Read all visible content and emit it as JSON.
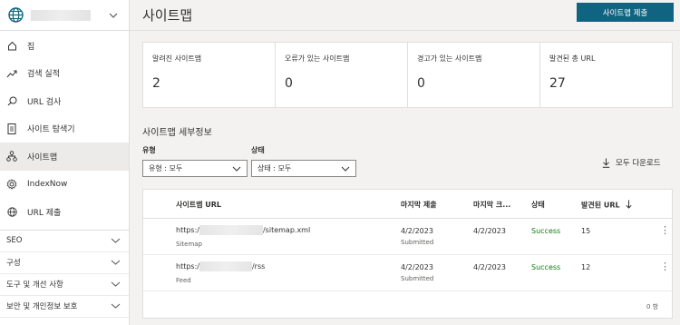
{
  "sidebar": {
    "items": [
      {
        "label": "집",
        "icon": "home-icon"
      },
      {
        "label": "검색 실적",
        "icon": "trend-icon"
      },
      {
        "label": "URL 검사",
        "icon": "search-icon"
      },
      {
        "label": "사이트 탐색기",
        "icon": "document-icon"
      },
      {
        "label": "사이트맵",
        "icon": "sitemap-icon",
        "active": true
      },
      {
        "label": "IndexNow",
        "icon": "gear-icon"
      },
      {
        "label": "URL 제출",
        "icon": "globe-icon"
      }
    ],
    "groups": [
      "SEO",
      "구성",
      "도구 및 개선 사항",
      "보안 및 개인정보 보호"
    ]
  },
  "header": {
    "title": "사이트맵",
    "submit_label": "사이트맵 제출"
  },
  "stats": [
    {
      "label": "알려진 사이트맵",
      "value": "2"
    },
    {
      "label": "오류가 있는 사이트맵",
      "value": "0"
    },
    {
      "label": "경고가 있는 사이트맵",
      "value": "0"
    },
    {
      "label": "발견된 총 URL",
      "value": "27"
    }
  ],
  "details": {
    "title": "사이트맵 세부정보",
    "type_label": "유형",
    "type_value": "유형 : 모두",
    "status_label": "상태",
    "status_value": "상태 : 모두",
    "download_label": "모두 다운로드"
  },
  "table": {
    "columns": [
      "사이트맵 URL",
      "마지막 제출",
      "마지막 크...",
      "상태",
      "발견된 URL"
    ],
    "rows": [
      {
        "url_prefix": "https:/",
        "url_suffix": "/sitemap.xml",
        "type": "Sitemap",
        "last_submitted": "4/2/2023",
        "submitted_label": "Submitted",
        "last_crawled": "4/2/2023",
        "status": "Success",
        "discovered": "15"
      },
      {
        "url_prefix": "https:/",
        "url_suffix": "/rss",
        "type": "Feed",
        "last_submitted": "4/2/2023",
        "submitted_label": "Submitted",
        "last_crawled": "4/2/2023",
        "status": "Success",
        "discovered": "12"
      }
    ],
    "count_text": "0 항"
  },
  "colors": {
    "accent": "#106481",
    "success": "#107c10"
  }
}
